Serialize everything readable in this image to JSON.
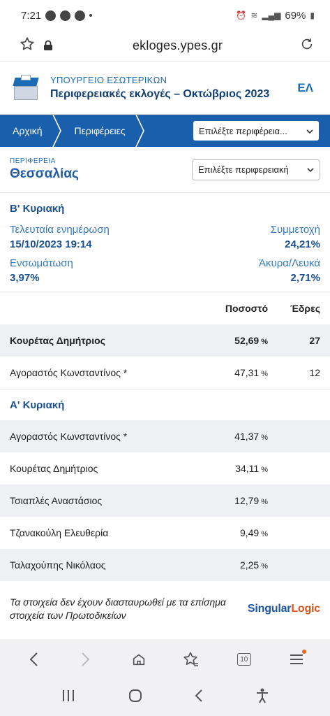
{
  "status_bar": {
    "time": "7:21",
    "battery": "69%"
  },
  "browser": {
    "url": "ekloges.ypes.gr"
  },
  "header": {
    "ministry": "ΥΠΟΥΡΓΕΙΟ ΕΣΩΤΕΡΙΚΩΝ",
    "title": "Περιφερειακές εκλογές – Οκτώβριος 2023",
    "lang": "ΕΛ"
  },
  "breadcrumb": {
    "home": "Αρχική",
    "regions": "Περιφέρειες",
    "select_placeholder": "Επιλέξτε περιφέρεια..."
  },
  "region": {
    "label": "ΠΕΡΙΦΕΡΕΙΑ",
    "name": "Θεσσαλίας",
    "select_placeholder": "Επιλέξτε περιφερειακή"
  },
  "round_b": {
    "title": "Β' Κυριακή",
    "last_update_label": "Τελευταία ενημέρωση",
    "last_update_value": "15/10/2023 19:14",
    "turnout_label": "Συμμετοχή",
    "turnout_value": "24,21%",
    "integration_label": "Ενσωμάτωση",
    "integration_value": "3,97%",
    "invalid_label": "Άκυρα/Λευκά",
    "invalid_value": "2,71%"
  },
  "table": {
    "pct_header": "Ποσοστό",
    "seats_header": "Έδρες",
    "pct_unit": "%"
  },
  "round_b_rows": [
    {
      "name": "Κουρέτας Δημήτριος",
      "pct": "52,69",
      "seats": "27"
    },
    {
      "name": "Αγοραστός Κωνσταντίνος *",
      "pct": "47,31",
      "seats": "12"
    }
  ],
  "round_a": {
    "title": "Α' Κυριακή"
  },
  "round_a_rows": [
    {
      "name": "Αγοραστός Κωνσταντίνος *",
      "pct": "41,37"
    },
    {
      "name": "Κουρέτας Δημήτριος",
      "pct": "34,11"
    },
    {
      "name": "Τσιαπλές Αναστάσιος",
      "pct": "12,79"
    },
    {
      "name": "Τζανακούλη Ελευθερία",
      "pct": "9,49"
    },
    {
      "name": "Ταλαχούπης Νικόλαος",
      "pct": "2,25"
    }
  ],
  "footnote": {
    "text": "Τα στοιχεία δεν έχουν διασταυρωθεί με τα επίσημα στοιχεία των Πρωτοδικείων",
    "brand_singular": "Singular",
    "brand_logic": "Logic"
  },
  "browser_nav": {
    "tab_count": "10"
  },
  "icons": [
    "star-icon",
    "lock-icon",
    "reload-icon",
    "back-icon",
    "forward-icon",
    "home-icon",
    "favorites-icon",
    "tabs-icon",
    "menu-icon",
    "recents-icon",
    "home-circle-icon",
    "sys-back-icon",
    "accessibility-icon"
  ]
}
